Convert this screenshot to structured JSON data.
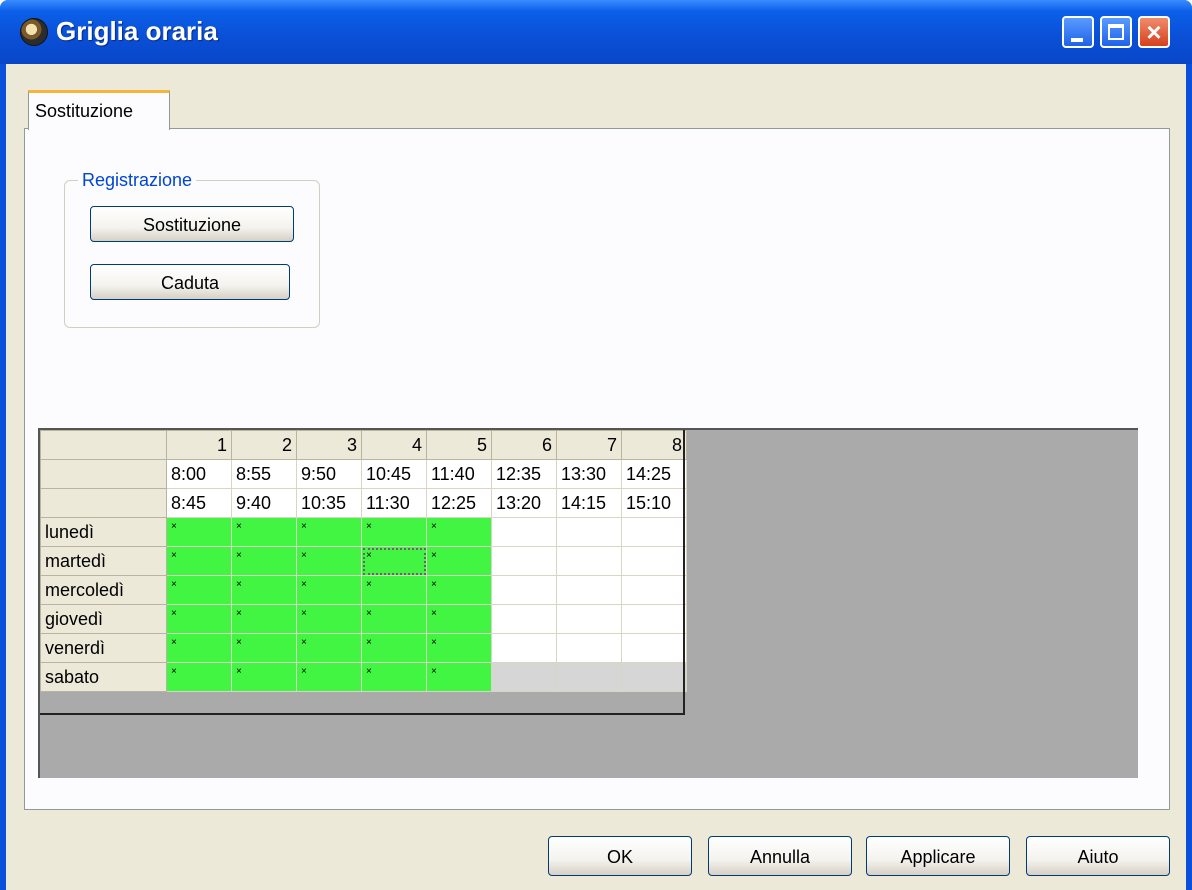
{
  "window": {
    "title": "Griglia oraria",
    "icon": "clock-icon",
    "controls": {
      "minimize": "minimize-icon",
      "maximize": "maximize-icon",
      "close": "close-icon"
    }
  },
  "tabs": [
    {
      "label": "Sostituzione",
      "active": true
    }
  ],
  "registration": {
    "legend": "Registrazione",
    "buttons": {
      "sostituzione": "Sostituzione",
      "caduta": "Caduta"
    }
  },
  "grid": {
    "periods": [
      "1",
      "2",
      "3",
      "4",
      "5",
      "6",
      "7",
      "8"
    ],
    "start_times": [
      "8:00",
      "8:55",
      "9:50",
      "10:45",
      "11:40",
      "12:35",
      "13:30",
      "14:25"
    ],
    "end_times": [
      "8:45",
      "9:40",
      "10:35",
      "11:30",
      "12:25",
      "13:20",
      "14:15",
      "15:10"
    ],
    "days": [
      "lunedì",
      "martedì",
      "mercoledì",
      "giovedì",
      "venerdì",
      "sabato"
    ],
    "cell_mark": "×",
    "marked_periods_per_day": 5,
    "selected_cell": {
      "day": "martedì",
      "period": "4"
    },
    "colors": {
      "marked": "#42f542",
      "unavailable": "#d6d6d6",
      "empty": "#ffffff"
    }
  },
  "footer": {
    "ok": "OK",
    "annulla": "Annulla",
    "applicare": "Applicare",
    "aiuto": "Aiuto"
  }
}
